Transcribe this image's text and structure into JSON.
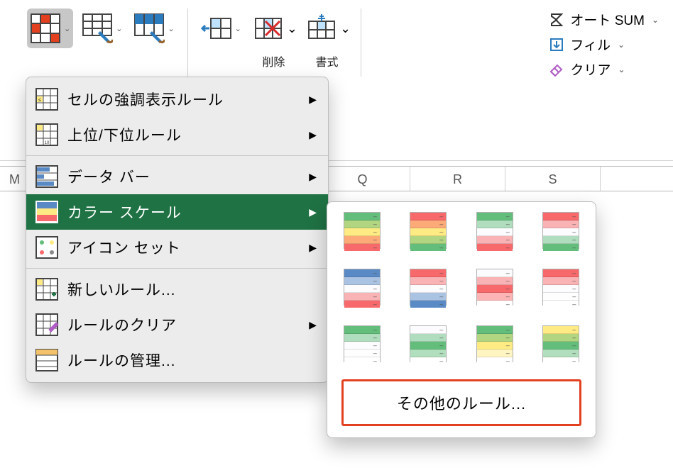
{
  "ribbon": {
    "delete_label": "削除",
    "format_label": "書式"
  },
  "right": {
    "autosum": "オート SUM",
    "fill": "フィル",
    "clear": "クリア"
  },
  "cols": [
    "M",
    "",
    "",
    "",
    "Q",
    "R",
    "S"
  ],
  "menu": {
    "highlight_rules": "セルの強調表示ルール",
    "top_bottom": "上位/下位ルール",
    "data_bars": "データ バー",
    "color_scales": "カラー スケール",
    "icon_sets": "アイコン セット",
    "new_rule": "新しいルール...",
    "clear_rules": "ルールのクリア",
    "manage_rules": "ルールの管理..."
  },
  "submenu": {
    "more_rules": "その他のルール...",
    "scales": [
      [
        "#63be7b",
        "#ffeb84",
        "#f8696b"
      ],
      [
        "#f8696b",
        "#ffeb84",
        "#63be7b"
      ],
      [
        "#63be7b",
        "#fcfcff",
        "#f8696b"
      ],
      [
        "#f8696b",
        "#fcfcff",
        "#63be7b"
      ],
      [
        "#5a8ac6",
        "#fcfcff",
        "#f8696b"
      ],
      [
        "#f8696b",
        "#fcfcff",
        "#5a8ac6"
      ],
      [
        "#fcfcff",
        "#f8696b",
        "#ffffff"
      ],
      [
        "#f8696b",
        "#fcfcff",
        "#ffffff"
      ],
      [
        "#63be7b",
        "#fcfcff",
        "#ffffff"
      ],
      [
        "#fcfcff",
        "#63be7b",
        "#ffffff"
      ],
      [
        "#63be7b",
        "#ffeb84",
        "#ffffff"
      ],
      [
        "#ffeb84",
        "#63be7b",
        "#ffffff"
      ]
    ]
  }
}
